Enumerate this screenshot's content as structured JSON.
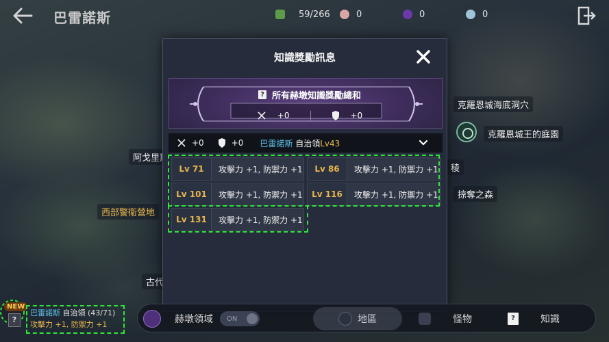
{
  "topbar": {
    "region_title": "巴雷諾斯",
    "resources": [
      {
        "icon": "green-gem-icon",
        "value": "59/266",
        "color": "#5d9b4a"
      },
      {
        "icon": "pearl-icon",
        "value": "0",
        "color": "#d9a6a6"
      },
      {
        "icon": "purple-orb-icon",
        "value": "0",
        "color": "#6b3aa8"
      },
      {
        "icon": "silver-coin-icon",
        "value": "0",
        "color": "#9fc3d8"
      }
    ]
  },
  "map_labels": {
    "west_guard_camp": "西部警衛營地",
    "agoris": "阿戈里斯",
    "ancient_stone": "古代石室",
    "grotto": "克羅恩城海底洞穴",
    "royal_garden": "克羅恩城王的庭園",
    "plunder_forest": "掠奪之森",
    "right_edge": "稜"
  },
  "modal": {
    "title": "知識獎勵訊息",
    "banner_heading": "所有赫墩知識獎勵總和",
    "banner_attack": "+0",
    "banner_defense": "+0",
    "subbar_attack": "+0",
    "subbar_defense": "+0",
    "region_name": "巴雷諾斯",
    "region_type": " 自治領",
    "region_level": "Lv43",
    "rewards": [
      {
        "level": "Lv 71",
        "bonus": "攻擊力 +1, 防禦力 +1"
      },
      {
        "level": "Lv 86",
        "bonus": "攻擊力 +1, 防禦力 +1"
      },
      {
        "level": "Lv 101",
        "bonus": "攻擊力 +1, 防禦力 +1"
      },
      {
        "level": "Lv 116",
        "bonus": "攻擊力 +1, 防禦力 +1"
      },
      {
        "level": "Lv 131",
        "bonus": "攻擊力 +1, 防禦力 +1"
      }
    ]
  },
  "bottombar": {
    "domain_label": "赫墩領域",
    "toggle_label": "ON",
    "region_tab": "地區",
    "monster_tab": "怪物",
    "knowledge_tab": "知識"
  },
  "notification": {
    "badge": "NEW",
    "region_name": "巴雷諾斯",
    "region_progress": " 自治領 (43/71)",
    "bonus": "攻擊力 +1, 防禦力 +1"
  },
  "colors": {
    "accent_gold": "#e8b64e",
    "accent_cyan": "#5ec1e6",
    "highlight_green": "#2ee63a"
  }
}
